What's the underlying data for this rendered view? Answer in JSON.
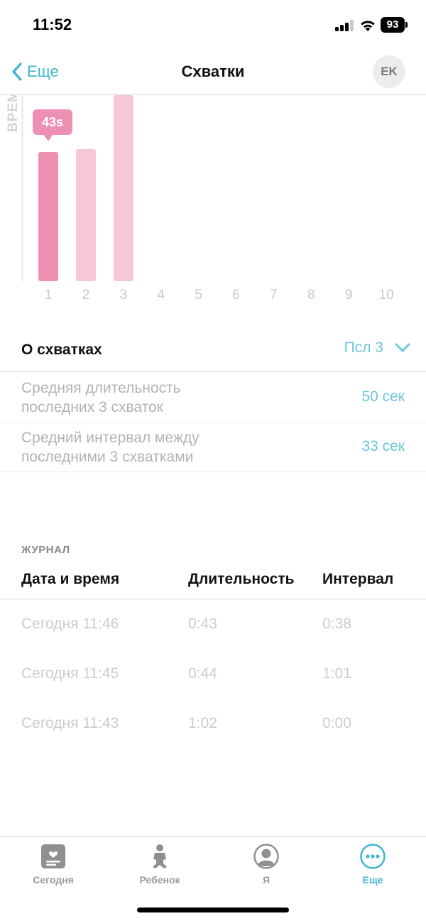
{
  "status_bar": {
    "time": "11:52",
    "battery": "93"
  },
  "nav": {
    "back_label": "Еще",
    "title": "Схватки",
    "avatar_initials": "EK"
  },
  "chart_data": {
    "type": "bar",
    "ylabel": "ВРЕМЯ",
    "categories": [
      "1",
      "2",
      "3",
      "4",
      "5",
      "6",
      "7",
      "8",
      "9",
      "10"
    ],
    "values": [
      43,
      44,
      62,
      null,
      null,
      null,
      null,
      null,
      null,
      null
    ],
    "unit": "s",
    "selected_index": 0,
    "selected_label": "43s",
    "colors": {
      "active": "#ee8fb4",
      "inactive": "#f6c7d9"
    }
  },
  "stats": {
    "title": "О схватках",
    "range_label": "Псл 3",
    "rows": [
      {
        "label": "Средняя длительность последних 3 схваток",
        "value": "50 сек"
      },
      {
        "label": "Средний интервал между последними 3 схватками",
        "value": "33 сек"
      }
    ]
  },
  "journal": {
    "caption": "ЖУРНАЛ",
    "headers": [
      "Дата и время",
      "Длительность",
      "Интервал"
    ],
    "rows": [
      {
        "date": "Сегодня 11:46",
        "duration": "0:43",
        "interval": "0:38"
      },
      {
        "date": "Сегодня 11:45",
        "duration": "0:44",
        "interval": "1:01"
      },
      {
        "date": "Сегодня 11:43",
        "duration": "1:02",
        "interval": "0:00"
      }
    ]
  },
  "tabs": [
    {
      "label": "Сегодня",
      "icon": "today-icon",
      "active": false
    },
    {
      "label": "Ребенок",
      "icon": "baby-icon",
      "active": false
    },
    {
      "label": "Я",
      "icon": "profile-icon",
      "active": false
    },
    {
      "label": "Еще",
      "icon": "more-icon",
      "active": true
    }
  ],
  "colors": {
    "accent": "#3fb6cf",
    "accent_light": "#6cc7d9"
  }
}
